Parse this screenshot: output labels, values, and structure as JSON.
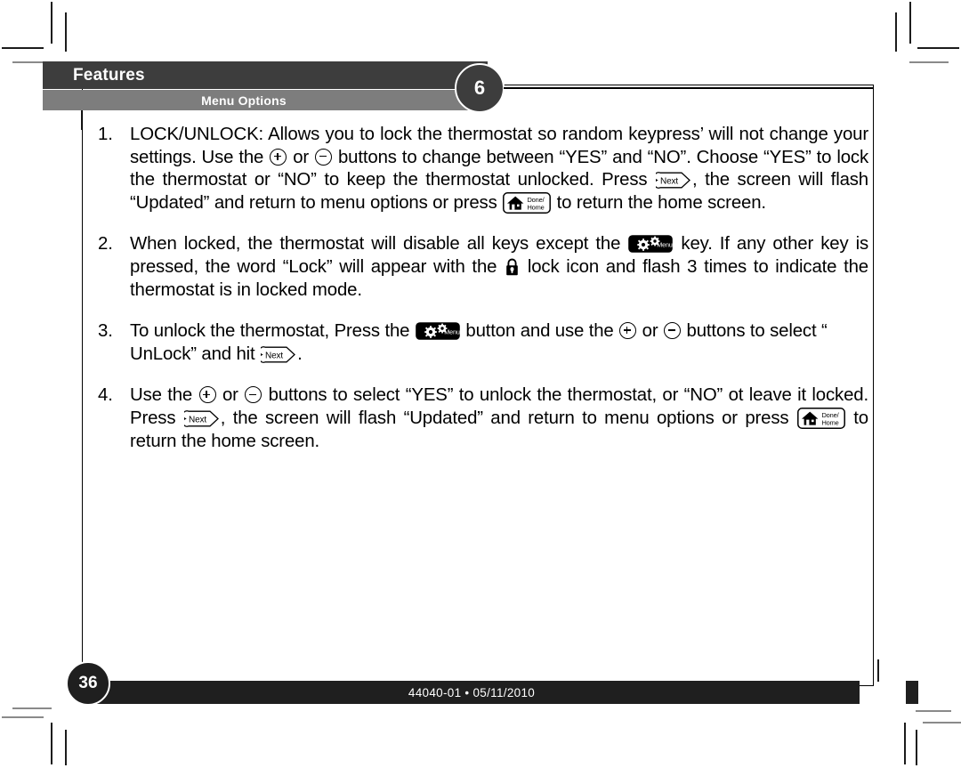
{
  "header": {
    "section_title": "Features",
    "subsection_title": "Menu Options",
    "chapter_number": "6"
  },
  "footer": {
    "page_number": "36",
    "doc_code": "44040-01 • 05/11/2010"
  },
  "icons": {
    "plus": "plus-button-icon",
    "minus": "minus-button-icon",
    "next": "next-button-icon",
    "menu": "menu-button-icon",
    "home": "done-home-button-icon",
    "lock": "lock-icon",
    "next_label": "Next",
    "menu_label": "Menu",
    "home_label_line1": "Done/",
    "home_label_line2": "Home"
  },
  "body": {
    "items": [
      {
        "number": "1.",
        "segments": [
          {
            "type": "text",
            "value": "LOCK/UNLOCK: Allows you to lock the thermostat so random keypress’ will not change your settings. Use the "
          },
          {
            "type": "icon",
            "value": "plus"
          },
          {
            "type": "text",
            "value": " or "
          },
          {
            "type": "icon",
            "value": "minus"
          },
          {
            "type": "text",
            "value": " buttons to change between “YES” and “NO”. Choose “YES” to lock the thermostat or “NO” to keep the thermostat unlocked. Press "
          },
          {
            "type": "icon",
            "value": "next"
          },
          {
            "type": "text",
            "value": ", the screen will flash “Updated” and return to menu options or press "
          },
          {
            "type": "icon",
            "value": "home"
          },
          {
            "type": "text",
            "value": " to return the home screen."
          }
        ]
      },
      {
        "number": "2.",
        "segments": [
          {
            "type": "text",
            "value": "When locked, the thermostat will disable all keys except the "
          },
          {
            "type": "icon",
            "value": "menu"
          },
          {
            "type": "text",
            "value": " key. If any other key is pressed, the word “Lock” will appear with the "
          },
          {
            "type": "icon",
            "value": "lock"
          },
          {
            "type": "text",
            "value": " lock icon and flash 3 times to indicate the thermostat is in locked mode."
          }
        ]
      },
      {
        "number": "3.",
        "segments": [
          {
            "type": "text",
            "value": " To unlock the thermostat, Press the "
          },
          {
            "type": "icon",
            "value": "menu"
          },
          {
            "type": "text",
            "value": " button and use the "
          },
          {
            "type": "icon",
            "value": "plus"
          },
          {
            "type": "text",
            "value": " or "
          },
          {
            "type": "icon",
            "value": "minus"
          },
          {
            "type": "text",
            "value": " buttons to select “ UnLock” and hit "
          },
          {
            "type": "icon",
            "value": "next"
          },
          {
            "type": "text",
            "value": "."
          }
        ]
      },
      {
        "number": "4.",
        "segments": [
          {
            "type": "text",
            "value": "Use the "
          },
          {
            "type": "icon",
            "value": "plus"
          },
          {
            "type": "text",
            "value": " or "
          },
          {
            "type": "icon",
            "value": "minus"
          },
          {
            "type": "text",
            "value": " buttons to select “YES” to unlock the thermostat, or “NO” ot leave it locked. Press "
          },
          {
            "type": "icon",
            "value": "next"
          },
          {
            "type": "text",
            "value": ", the screen will flash “Updated” and return to menu options or press "
          },
          {
            "type": "icon",
            "value": "home"
          },
          {
            "type": "text",
            "value": " to return the home screen."
          }
        ]
      }
    ]
  },
  "colors": {
    "banner_dark": "#3d3d3d",
    "banner_light": "#7d7d7d",
    "footer_dark": "#1f1f1f",
    "page_background": "#ffffff"
  }
}
